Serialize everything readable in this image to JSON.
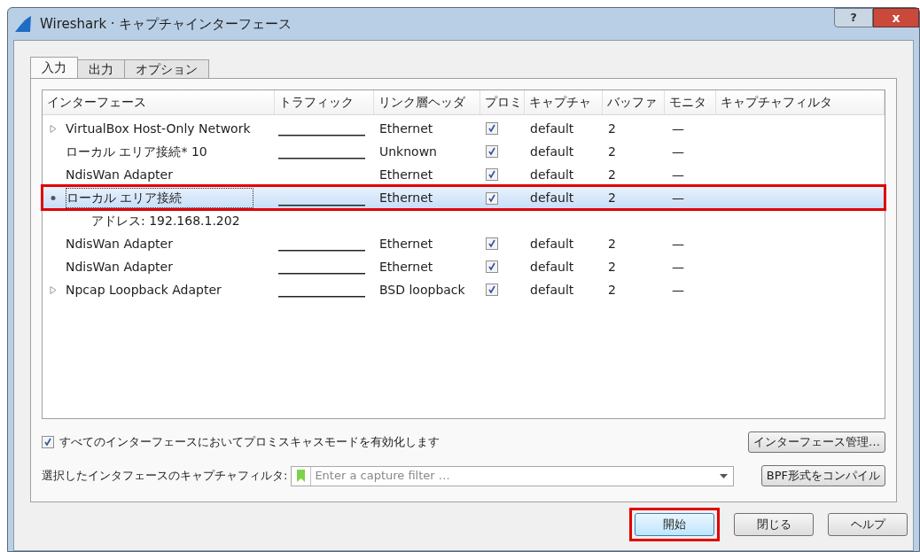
{
  "window": {
    "title": "Wireshark · キャプチャインターフェース",
    "help_button": "?",
    "close_button": "x"
  },
  "tabs": [
    {
      "label": "入力",
      "selected": true
    },
    {
      "label": "出力",
      "selected": false
    },
    {
      "label": "オプション",
      "selected": false
    }
  ],
  "table": {
    "columns": [
      "インターフェース",
      "トラフィック",
      "リンク層ヘッダ",
      "プロミ",
      "キャプチャ",
      "バッファ",
      "モニタ",
      "キャプチャフィルタ"
    ],
    "rows": [
      {
        "name": "VirtualBox Host-Only Network",
        "expandable": true,
        "expanded": false,
        "traffic": true,
        "link": "Ethernet",
        "promisc": true,
        "capture": "default",
        "buffer": "2",
        "monitor": "—",
        "selected": false,
        "highlighted": false
      },
      {
        "name": "ローカル エリア接続* 10",
        "expandable": false,
        "expanded": false,
        "traffic": true,
        "link": "Unknown",
        "promisc": true,
        "capture": "default",
        "buffer": "2",
        "monitor": "—",
        "selected": false,
        "highlighted": false
      },
      {
        "name": "NdisWan Adapter",
        "expandable": false,
        "expanded": false,
        "traffic": false,
        "link": "Ethernet",
        "promisc": true,
        "capture": "default",
        "buffer": "2",
        "monitor": "—",
        "selected": false,
        "highlighted": false
      },
      {
        "name": "ローカル エリア接続",
        "expandable": true,
        "expanded": true,
        "traffic": true,
        "link": "Ethernet",
        "promisc": true,
        "capture": "default",
        "buffer": "2",
        "monitor": "—",
        "selected": true,
        "highlighted": true,
        "children": [
          {
            "name": "アドレス: 192.168.1.202"
          }
        ]
      },
      {
        "name": "NdisWan Adapter",
        "expandable": false,
        "expanded": false,
        "traffic": true,
        "link": "Ethernet",
        "promisc": true,
        "capture": "default",
        "buffer": "2",
        "monitor": "—",
        "selected": false,
        "highlighted": false
      },
      {
        "name": "NdisWan Adapter",
        "expandable": false,
        "expanded": false,
        "traffic": true,
        "link": "Ethernet",
        "promisc": true,
        "capture": "default",
        "buffer": "2",
        "monitor": "—",
        "selected": false,
        "highlighted": false
      },
      {
        "name": "Npcap Loopback Adapter",
        "expandable": true,
        "expanded": false,
        "traffic": true,
        "link": "BSD loopback",
        "promisc": true,
        "capture": "default",
        "buffer": "2",
        "monitor": "—",
        "selected": false,
        "highlighted": false
      }
    ]
  },
  "promisc_all": {
    "label": "すべてのインターフェースにおいてプロミスキャスモードを有効化します",
    "checked": true
  },
  "manage_button": "インターフェース管理…",
  "filter": {
    "label": "選択したインタフェースのキャプチャフィルタ:",
    "placeholder": "Enter a capture filter …"
  },
  "compile_button": "BPF形式をコンパイル",
  "buttons": [
    {
      "label": "開始",
      "highlighted": true
    },
    {
      "label": "閉じる",
      "highlighted": false
    },
    {
      "label": "ヘルプ",
      "highlighted": false
    }
  ]
}
